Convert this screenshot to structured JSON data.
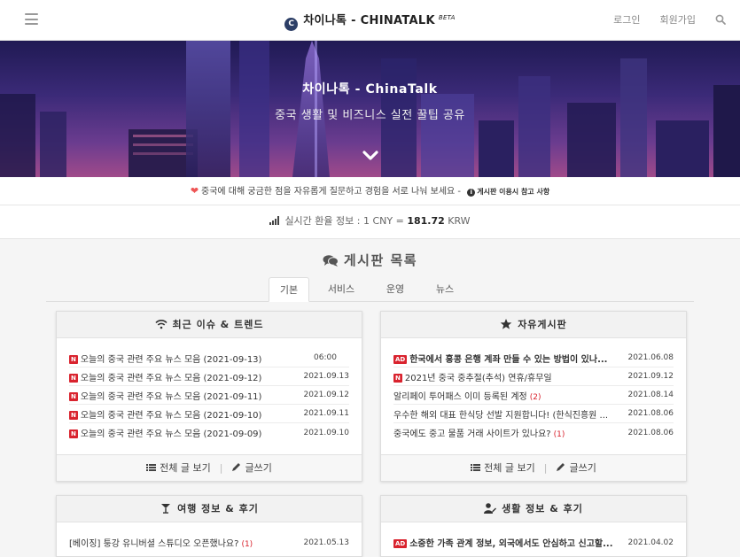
{
  "header": {
    "brand": "차이나톡 - CHINATALK",
    "beta": "BETA",
    "logo_letter": "C",
    "login": "로그인",
    "signup": "회원가입"
  },
  "hero": {
    "title": "차이나톡 - ChinaTalk",
    "subtitle": "중국 생활 및 비즈니스 실전 꿀팁 공유"
  },
  "notice": {
    "text": "중국에 대해 궁금한 점을 자유롭게 질문하고 경험을 서로 나눠 보세요 -",
    "guide": "게시판 이용시 참고 사항"
  },
  "rate": {
    "label": "실시간 환율 정보 : 1 CNY =",
    "value": "181.72",
    "unit": "KRW"
  },
  "boards": {
    "heading": "게시판 목록",
    "tabs": [
      "기본",
      "서비스",
      "운영",
      "뉴스"
    ],
    "active_tab": "기본"
  },
  "panels": {
    "trend": {
      "title": "최근 이슈 & 트렌드",
      "rows": [
        {
          "badge": "N",
          "title": "오늘의 중국 관련 주요 뉴스 모음 (2021-09-13)",
          "date": "06:00"
        },
        {
          "badge": "N",
          "title": "오늘의 중국 관련 주요 뉴스 모음 (2021-09-12)",
          "date": "2021.09.13"
        },
        {
          "badge": "N",
          "title": "오늘의 중국 관련 주요 뉴스 모음 (2021-09-11)",
          "date": "2021.09.12"
        },
        {
          "badge": "N",
          "title": "오늘의 중국 관련 주요 뉴스 모음 (2021-09-10)",
          "date": "2021.09.11"
        },
        {
          "badge": "N",
          "title": "오늘의 중국 관련 주요 뉴스 모음 (2021-09-09)",
          "date": "2021.09.10"
        }
      ]
    },
    "free": {
      "title": "자유게시판",
      "rows": [
        {
          "badge": "AD",
          "title": "한국에서 홍콩 은행 계좌 만들 수 있는 방법이 있나...",
          "date": "2021.06.08",
          "bold": true
        },
        {
          "badge": "N",
          "title": "2021년 중국 중추절(추석) 연휴/휴무일",
          "date": "2021.09.12"
        },
        {
          "badge": "",
          "title": "알리페이 투어패스 이미 등록된 계정",
          "count": "(2)",
          "date": "2021.08.14"
        },
        {
          "badge": "",
          "title": "우수한 해외 대표 한식당 선발 지원합니다! (한식진흥원 ...",
          "date": "2021.08.06"
        },
        {
          "badge": "",
          "title": "중국에도 중고 물품 거래 사이트가 있나요?",
          "count": "(1)",
          "date": "2021.08.06"
        }
      ]
    },
    "travel": {
      "title": "여행 정보 & 후기",
      "rows": [
        {
          "badge": "",
          "title": "[베이징] 퉁강 유니버셜 스튜디오 오픈했나요?",
          "count": "(1)",
          "date": "2021.05.13"
        }
      ]
    },
    "life": {
      "title": "생활 정보 & 후기",
      "rows": [
        {
          "badge": "AD",
          "title": "소중한 가족 관계 정보, 외국에서도 안심하고 신고할...",
          "date": "2021.04.02",
          "bold": true
        }
      ]
    }
  },
  "footer": {
    "view_all": "전체 글 보기",
    "write": "글쓰기"
  },
  "colors": {
    "badge_red": "#d9232e",
    "hero_top": "#201a54",
    "hero_bottom": "#a04a8a",
    "heart": "#e55555"
  }
}
